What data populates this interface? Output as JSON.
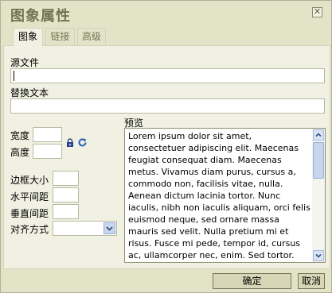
{
  "dialog": {
    "title": "图象属性",
    "close_icon": "close-icon"
  },
  "tabs": [
    {
      "label": "图象",
      "active": true
    },
    {
      "label": "链接",
      "active": false
    },
    {
      "label": "高级",
      "active": false
    }
  ],
  "fields": {
    "source_label": "源文件",
    "source_value": "",
    "alt_label": "替换文本",
    "alt_value": "",
    "width_label": "宽度",
    "width_value": "",
    "height_label": "高度",
    "height_value": "",
    "border_label": "边框大小",
    "border_value": "",
    "hspace_label": "水平间距",
    "hspace_value": "",
    "vspace_label": "垂直间距",
    "vspace_value": "",
    "align_label": "对齐方式",
    "align_value": ""
  },
  "icons": {
    "lock": "lock-icon",
    "reset": "reset-size-icon"
  },
  "preview": {
    "label": "预览",
    "text": "Lorem ipsum dolor sit amet, consectetuer adipiscing elit. Maecenas feugiat consequat diam. Maecenas metus. Vivamus diam purus, cursus a, commodo non, facilisis vitae, nulla. Aenean dictum lacinia tortor. Nunc iaculis, nibh non iaculis aliquam, orci felis euismod neque, sed ornare massa mauris sed velit. Nulla pretium mi et risus. Fusce mi pede, tempor id, cursus ac, ullamcorper nec, enim. Sed tortor."
  },
  "buttons": {
    "ok": "确定",
    "cancel": "取消"
  },
  "colors": {
    "dialog_bg": "#e3e3c7",
    "panel_bg": "#f1f1e3",
    "title": "#737357",
    "scroll_accent": "#c7d5ef"
  }
}
